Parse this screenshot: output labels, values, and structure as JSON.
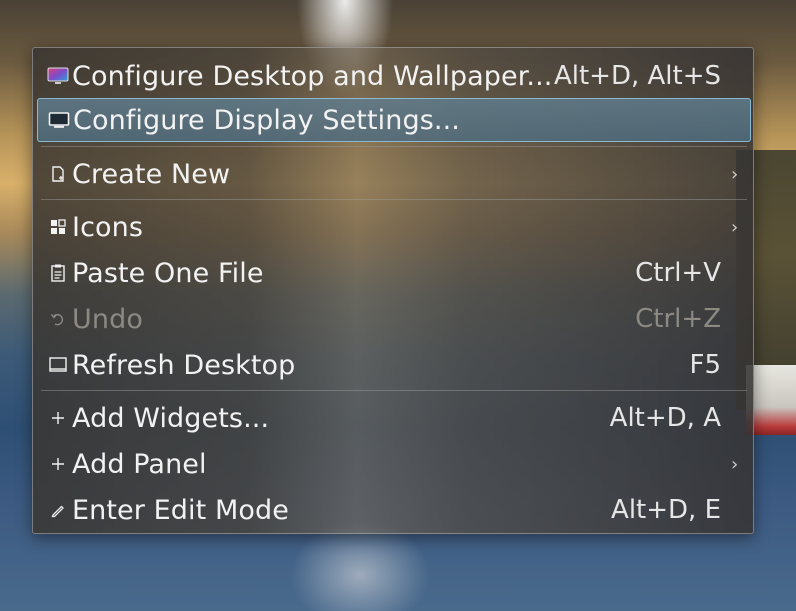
{
  "menu": {
    "items": [
      {
        "label": "Configure Desktop and Wallpaper...",
        "shortcut": "Alt+D, Alt+S",
        "icon": "desktop-wallpaper-icon"
      },
      {
        "label": "Configure Display Settings...",
        "shortcut": "",
        "icon": "monitor-icon",
        "state": "hovered"
      },
      {
        "label": "Create New",
        "shortcut": "",
        "icon": "new-document-icon",
        "submenu": "›"
      },
      {
        "label": "Icons",
        "shortcut": "",
        "icon": "icons-grid-icon",
        "submenu": "›"
      },
      {
        "label": "Paste One File",
        "shortcut": "Ctrl+V",
        "icon": "clipboard-icon"
      },
      {
        "label": "Undo",
        "shortcut": "Ctrl+Z",
        "icon": "undo-icon",
        "state": "disabled"
      },
      {
        "label": "Refresh Desktop",
        "shortcut": "F5",
        "icon": "refresh-desktop-icon"
      },
      {
        "label": "Add Widgets...",
        "shortcut": "Alt+D, A",
        "icon": "plus-icon"
      },
      {
        "label": "Add Panel",
        "shortcut": "",
        "icon": "plus-icon",
        "submenu": "›"
      },
      {
        "label": "Enter Edit Mode",
        "shortcut": "Alt+D, E",
        "icon": "pencil-icon"
      }
    ]
  },
  "colors": {
    "hover_border": "#8cbed7",
    "text": "#f2f2f2",
    "disabled_text": "#8d8a84"
  }
}
